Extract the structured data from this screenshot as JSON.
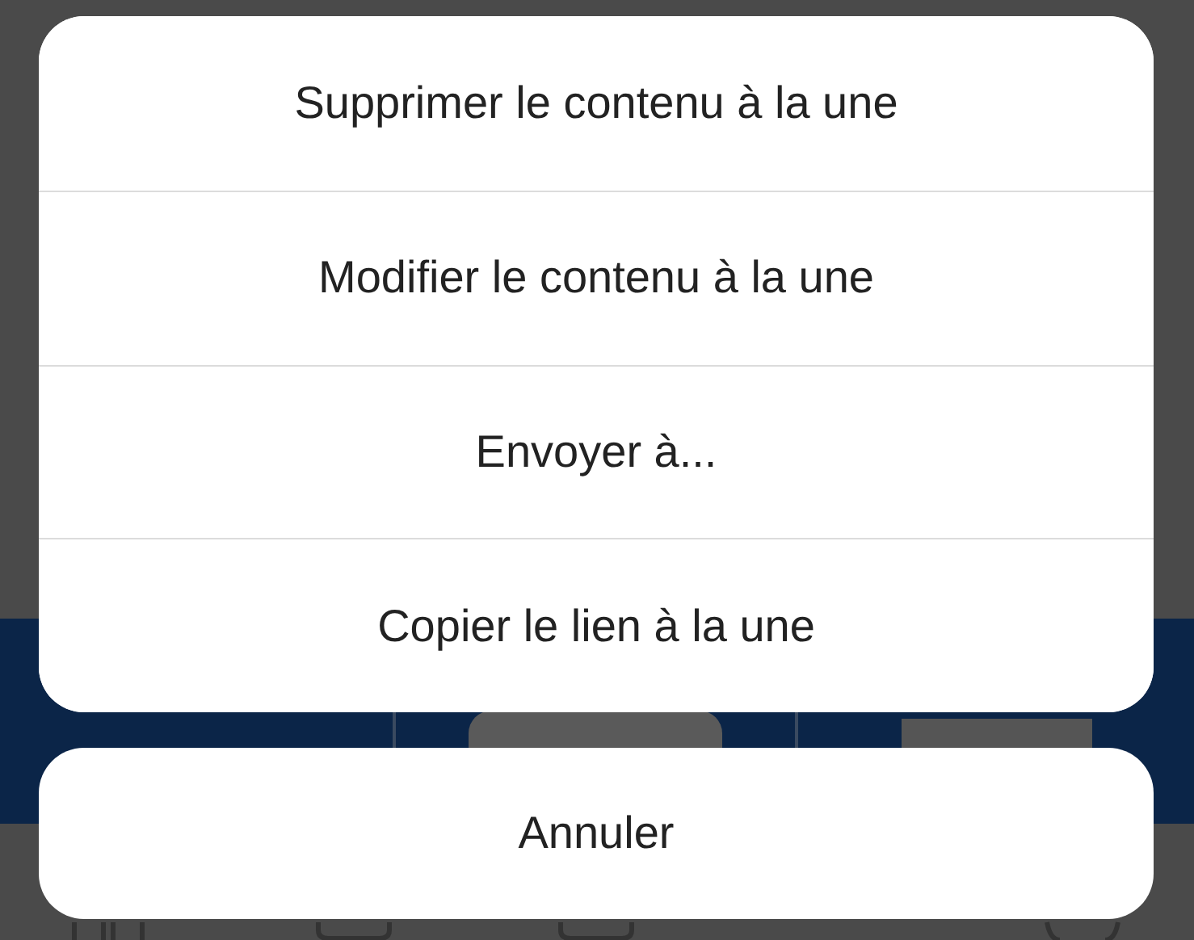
{
  "action_sheet": {
    "actions": [
      {
        "label": "Supprimer le contenu à la une"
      },
      {
        "label": "Modifier le contenu à la une"
      },
      {
        "label": "Envoyer à..."
      },
      {
        "label": "Copier le lien à la une"
      }
    ]
  },
  "cancel_button": {
    "label": "Annuler"
  }
}
